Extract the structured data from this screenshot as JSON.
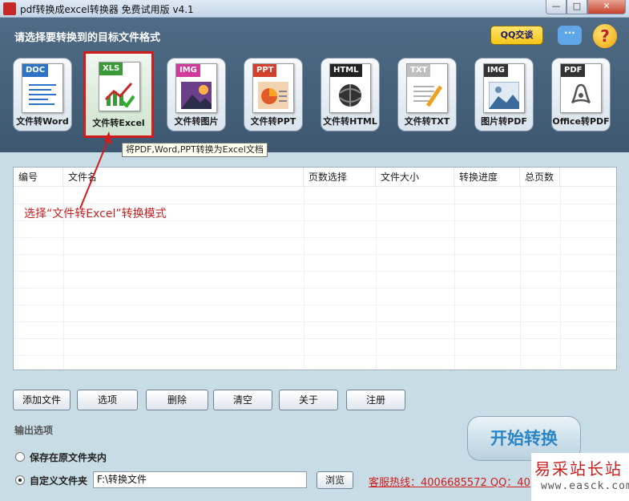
{
  "window": {
    "title": "pdf转换成excel转换器 免费试用版 v4.1",
    "min_glyph": "—",
    "max_glyph": "□",
    "close_glyph": "✕"
  },
  "header": {
    "title": "请选择要转换到的目标文件格式",
    "qq_badge": "QQ交谈",
    "help_glyph": "?"
  },
  "tools": [
    {
      "tag": "DOC",
      "label": "文件转Word",
      "color": "#2f73c4",
      "icon": "word-doc-icon"
    },
    {
      "tag": "XLS",
      "label": "文件转Excel",
      "color": "#3a9a3a",
      "icon": "excel-chart-icon"
    },
    {
      "tag": "IMG",
      "label": "文件转图片",
      "color": "#d03a9a",
      "icon": "image-file-icon"
    },
    {
      "tag": "PPT",
      "label": "文件转PPT",
      "color": "#d0402c",
      "icon": "ppt-file-icon"
    },
    {
      "tag": "HTML",
      "label": "文件转HTML",
      "color": "#222222",
      "icon": "html-globe-icon"
    },
    {
      "tag": "TXT",
      "label": "文件转TXT",
      "color": "#bfbfbf",
      "icon": "txt-pencil-icon"
    },
    {
      "tag": "IMG",
      "label": "图片转PDF",
      "color": "#333333",
      "icon": "picture-to-pdf-icon"
    },
    {
      "tag": "PDF",
      "label": "Office转PDF",
      "color": "#333333",
      "icon": "pdf-acrobat-icon"
    }
  ],
  "tooltip": "将PDF,Word,PPT转换为Excel文档",
  "annotation": "选择“文件转Excel”转换模式",
  "table": {
    "columns": [
      "编号",
      "文件名",
      "页数选择",
      "文件大小",
      "转换进度",
      "总页数"
    ]
  },
  "buttons": [
    "添加文件",
    "选项",
    "删除",
    "清空",
    "关于",
    "注册"
  ],
  "output": {
    "label": "输出选项",
    "option_same": "保存在原文件夹内",
    "option_custom": "自定义文件夹",
    "path_value": "F:\\转换文件",
    "browse": "浏览",
    "selected": "custom"
  },
  "hotline": "客服热线：4006685572 QQ：40",
  "start_button": "开始转换",
  "watermark": {
    "title": "易采站长站",
    "url": "www.easck.com"
  },
  "colors": {
    "accent_red": "#d01c1c",
    "header_bg": "#4a657f",
    "start_text": "#2a85c6"
  }
}
